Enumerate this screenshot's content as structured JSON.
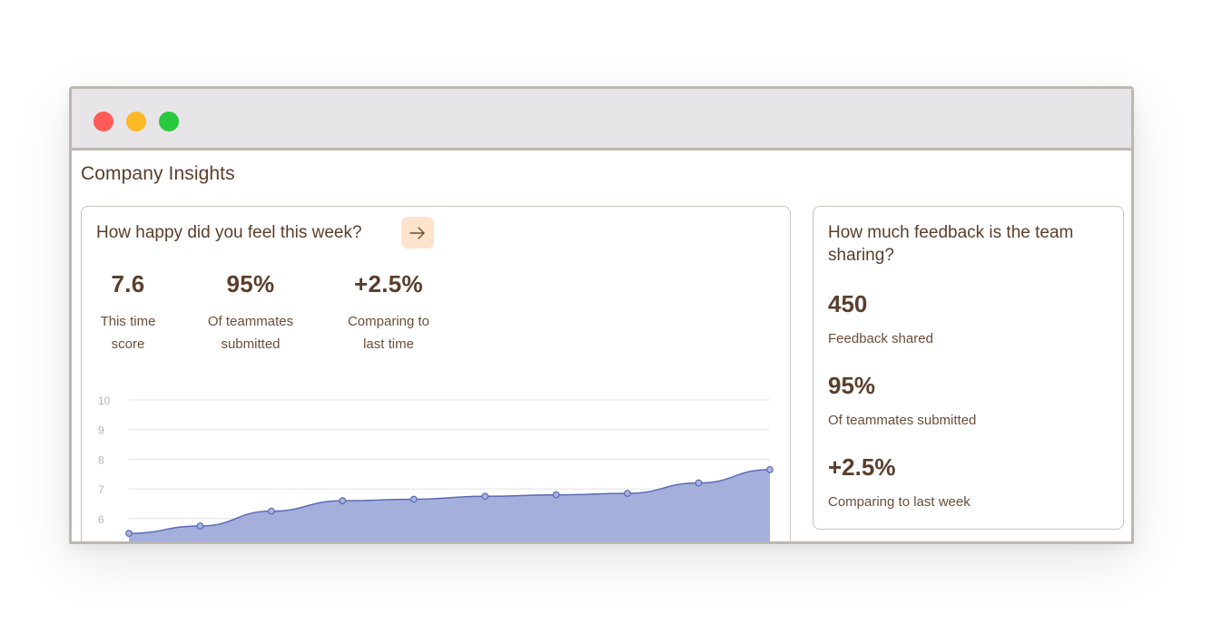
{
  "page": {
    "title": "Company Insights"
  },
  "happiness_card": {
    "question": "How happy did you feel this week?",
    "arrow_icon": "arrow-right-icon",
    "stats": [
      {
        "value": "7.6",
        "label_line1": "This time",
        "label_line2": "score"
      },
      {
        "value": "95%",
        "label_line1": "Of teammates",
        "label_line2": "submitted"
      },
      {
        "value": "+2.5%",
        "label_line1": "Comparing to",
        "label_line2": "last time"
      }
    ]
  },
  "feedback_card": {
    "question": "How much feedback is the team sharing?",
    "stats": [
      {
        "value": "450",
        "label": "Feedback shared"
      },
      {
        "value": "95%",
        "label": "Of teammates submitted"
      },
      {
        "value": "+2.5%",
        "label": "Comparing to last week"
      }
    ]
  },
  "colors": {
    "close": "#ff5b57",
    "minimize": "#fdb826",
    "maximize": "#29c940",
    "area_fill": "#a4afdc",
    "line": "#5a6bb5",
    "accent_button": "#fde2cc"
  },
  "chart_data": {
    "type": "area",
    "y_ticks": [
      "10",
      "9",
      "8",
      "7",
      "6"
    ],
    "ylim": [
      5.5,
      10
    ],
    "grid": true,
    "x": [
      1,
      2,
      3,
      4,
      5,
      6,
      7,
      8,
      9,
      10
    ],
    "values": [
      5.5,
      5.75,
      6.25,
      6.6,
      6.65,
      6.75,
      6.8,
      6.85,
      7.2,
      7.65
    ]
  }
}
